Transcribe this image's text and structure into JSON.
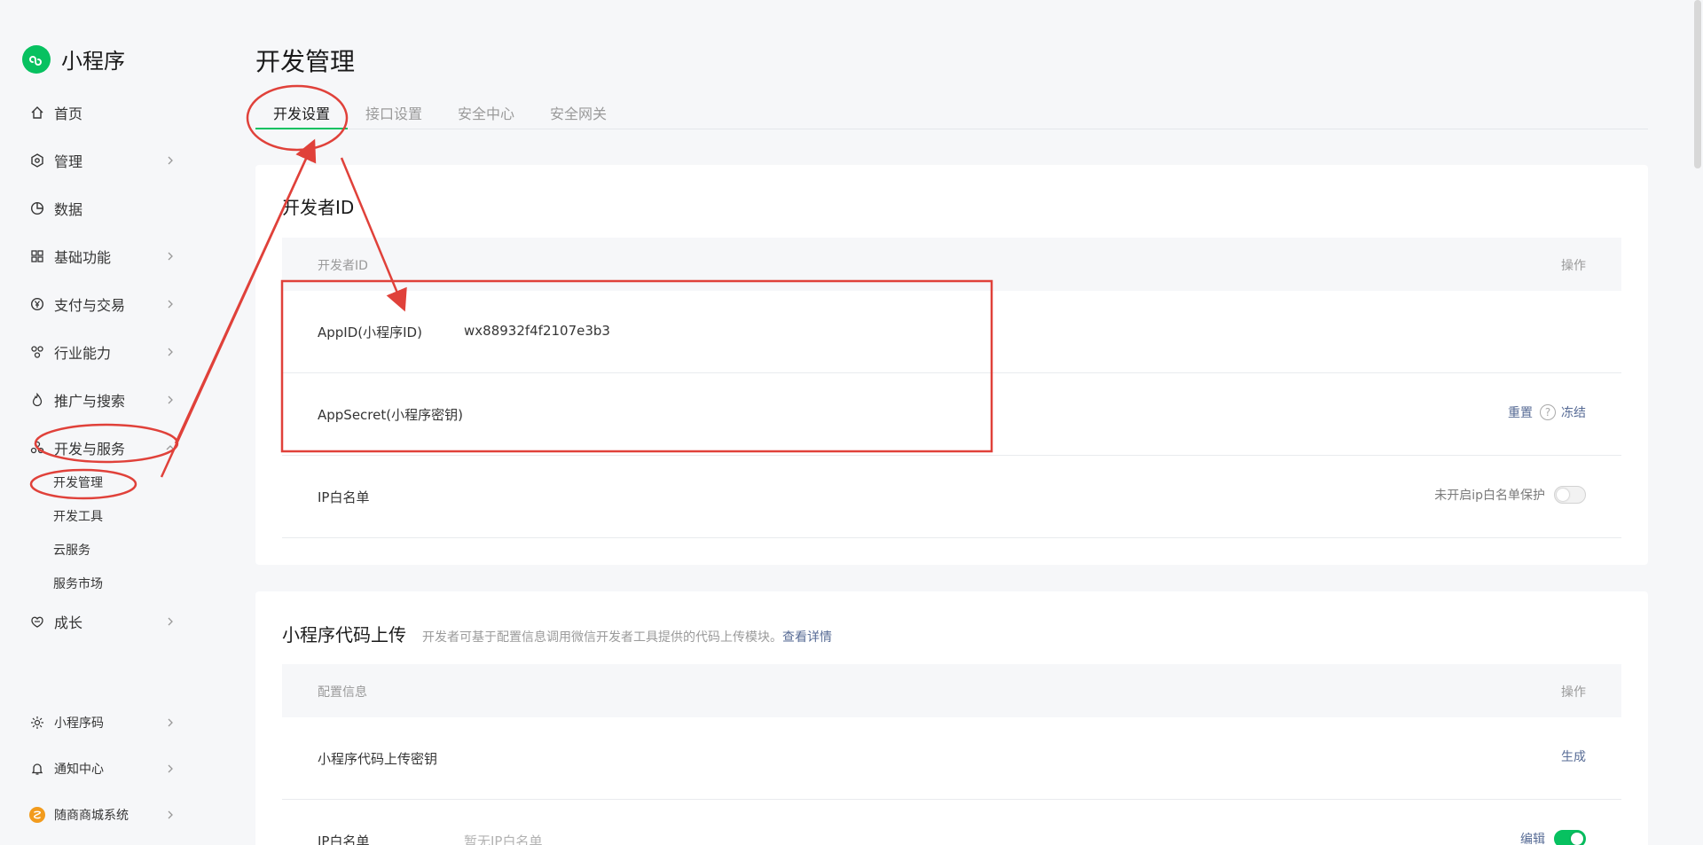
{
  "brand": {
    "name": "小程序"
  },
  "sidebar": {
    "items": [
      {
        "label": "首页",
        "icon": "home-icon"
      },
      {
        "label": "管理",
        "icon": "settings-icon"
      },
      {
        "label": "数据",
        "icon": "chart-icon"
      },
      {
        "label": "基础功能",
        "icon": "grid-icon"
      },
      {
        "label": "支付与交易",
        "icon": "yen-icon"
      },
      {
        "label": "行业能力",
        "icon": "nodes-icon"
      },
      {
        "label": "推广与搜索",
        "icon": "fire-icon"
      },
      {
        "label": "开发与服务",
        "icon": "dev-icon"
      }
    ],
    "sub_items": [
      "开发管理",
      "开发工具",
      "云服务",
      "服务市场"
    ],
    "growth": {
      "label": "成长",
      "icon": "growth-icon"
    },
    "bottom": [
      {
        "label": "小程序码",
        "icon": "sun-icon"
      },
      {
        "label": "通知中心",
        "icon": "bell-icon"
      },
      {
        "label": "随商商城系统",
        "icon": "app-avatar-icon"
      }
    ]
  },
  "page": {
    "title": "开发管理",
    "tabs": [
      "开发设置",
      "接口设置",
      "安全中心",
      "安全网关"
    ]
  },
  "dev_id_card": {
    "title": "开发者ID",
    "head_left": "开发者ID",
    "head_right": "操作",
    "rows": [
      {
        "key": "AppID(小程序ID)",
        "value": "wx88932f4f2107e3b3"
      },
      {
        "key": "AppSecret(小程序密钥)",
        "op_reset": "重置",
        "op_help": "?",
        "op_freeze": "冻结"
      },
      {
        "key": "IP白名单",
        "op_text": "未开启ip白名单保护"
      }
    ]
  },
  "upload_card": {
    "title": "小程序代码上传",
    "note": "开发者可基于配置信息调用微信开发者工具提供的代码上传模块。",
    "note_link": "查看详情",
    "head_left": "配置信息",
    "head_right": "操作",
    "rows": [
      {
        "key": "小程序代码上传密钥",
        "op": "生成"
      },
      {
        "key": "IP白名单",
        "value": "暂无IP白名单",
        "op": "编辑"
      }
    ]
  },
  "colors": {
    "brand_green": "#07c160",
    "link": "#576b95",
    "annotation_red": "#e0413a"
  }
}
